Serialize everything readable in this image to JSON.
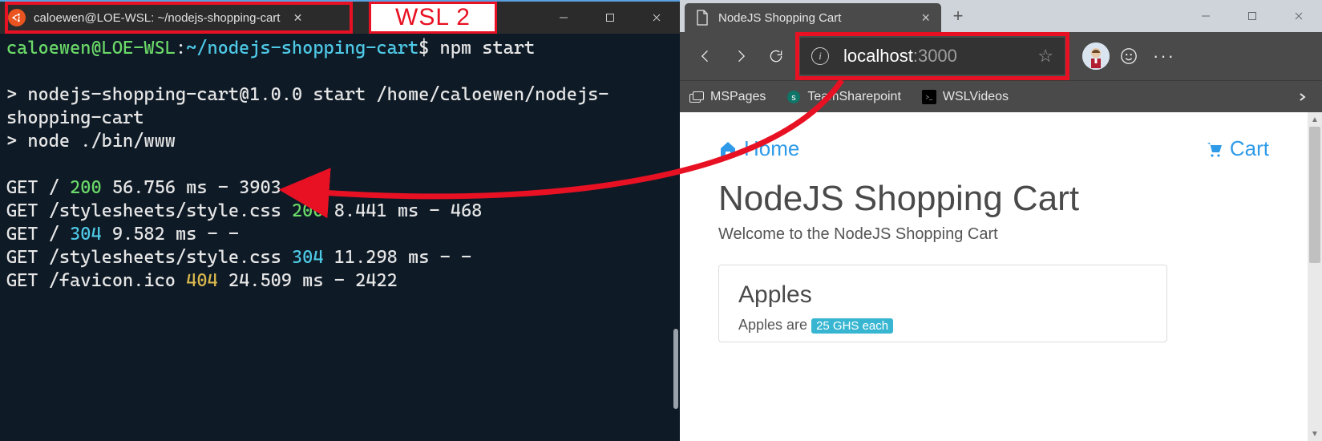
{
  "annotation": {
    "wsl_label": "WSL 2"
  },
  "terminal": {
    "tab_title": "caloewen@LOE-WSL: ~/nodejs-shopping-cart",
    "prompt_user": "caloewen@LOE-WSL",
    "prompt_sep": ":",
    "prompt_path": "~/nodejs-shopping-cart",
    "prompt_dollar": "$",
    "command": "npm start",
    "line_pkg": "> nodejs-shopping-cart@1.0.0 start /home/caloewen/nodejs-shopping-cart",
    "line_node": "> node ./bin/www",
    "logs": [
      {
        "m": "GET",
        "p": "/",
        "s": "200",
        "sc": "tgreen",
        "t": "56.756 ms",
        "b": "3903"
      },
      {
        "m": "GET",
        "p": "/stylesheets/style.css",
        "s": "200",
        "sc": "tgreen",
        "t": "8.441 ms",
        "b": "468"
      },
      {
        "m": "GET",
        "p": "/",
        "s": "304",
        "sc": "tcyan",
        "t": "9.582 ms",
        "b": "-"
      },
      {
        "m": "GET",
        "p": "/stylesheets/style.css",
        "s": "304",
        "sc": "tcyan",
        "t": "11.298 ms",
        "b": "-"
      },
      {
        "m": "GET",
        "p": "/favicon.ico",
        "s": "404",
        "sc": "tyellow",
        "t": "24.509 ms",
        "b": "2422"
      }
    ]
  },
  "browser": {
    "tab_title": "NodeJS Shopping Cart",
    "url_host": "localhost",
    "url_port": ":3000",
    "bookmarks": {
      "a": "MSPages",
      "b": "TeamSharepoint",
      "c": "WSLVideos"
    },
    "page": {
      "nav_home": "Home",
      "nav_cart": "Cart",
      "title": "NodeJS Shopping Cart",
      "subtitle": "Welcome to the NodeJS Shopping Cart",
      "product_title": "Apples",
      "product_desc_pre": "Apples are ",
      "product_price": "25 GHS each"
    }
  }
}
